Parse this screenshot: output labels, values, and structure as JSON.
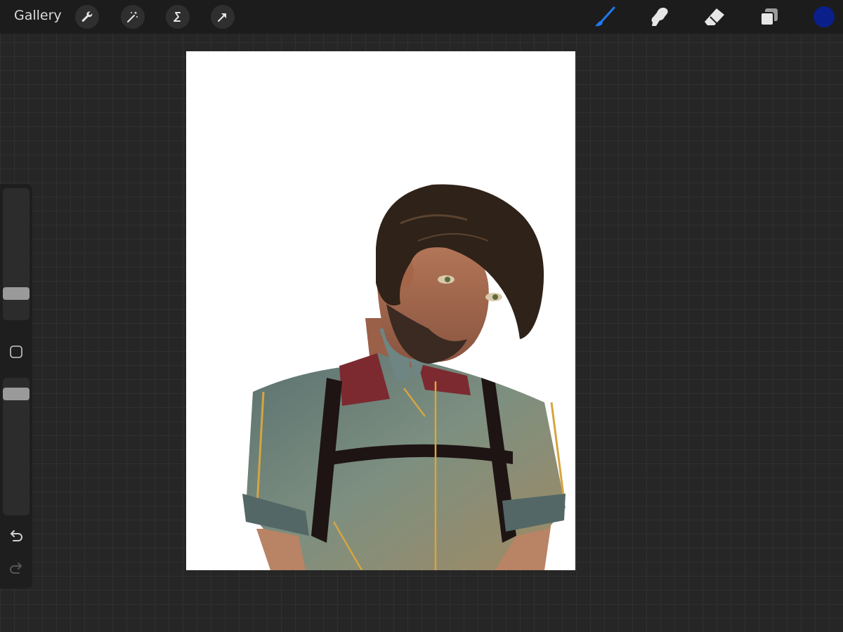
{
  "toolbar": {
    "gallery_label": "Gallery",
    "left_tools": [
      "wrench-icon",
      "magic-wand-icon",
      "selection-icon",
      "transform-arrow-icon"
    ],
    "right_tools": [
      "brush-icon",
      "smudge-icon",
      "eraser-icon",
      "layers-icon"
    ],
    "active_tool": "brush",
    "active_color": "#0a1f8a",
    "accent_color": "#1e7bf2"
  },
  "sidebar": {
    "brush_size_level": 0.17,
    "opacity_level": 0.92
  }
}
